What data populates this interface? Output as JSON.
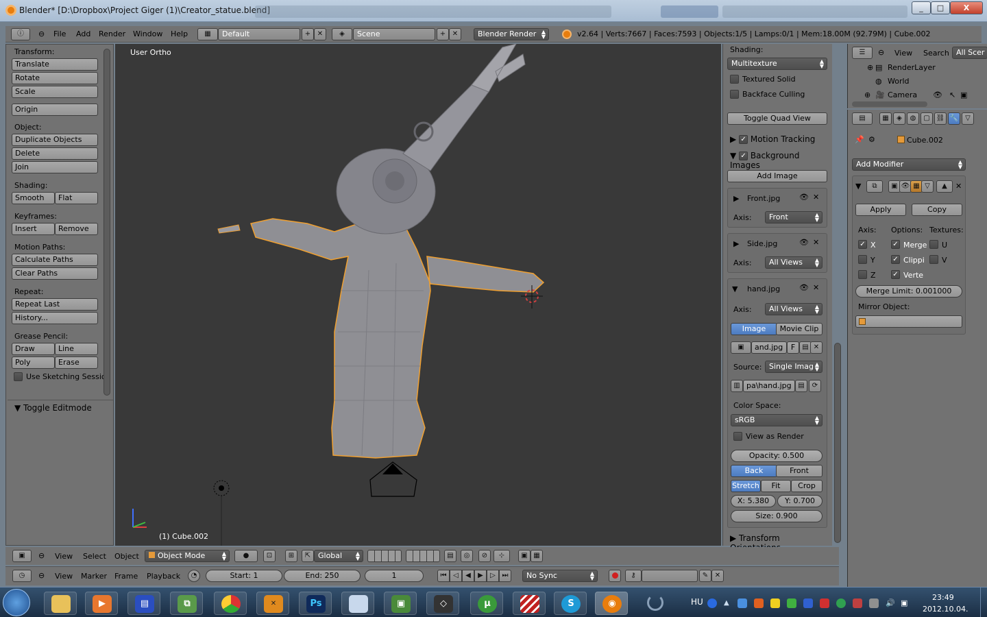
{
  "window": {
    "title": "Blender* [D:\\Dropbox\\Project Giger (1)\\Creator_statue.blend]",
    "min": "_",
    "max": "□",
    "close": "X"
  },
  "info_header": {
    "menus": [
      "File",
      "Add",
      "Render",
      "Window",
      "Help"
    ],
    "layout": "Default",
    "scene": "Scene",
    "engine": "Blender Render",
    "stats": "v2.64 | Verts:7667 | Faces:7593 | Objects:1/5 | Lamps:0/1 | Mem:18.00M (92.79M) | Cube.002"
  },
  "tool_shelf": {
    "transform_label": "Transform:",
    "translate": "Translate",
    "rotate": "Rotate",
    "scale": "Scale",
    "origin": "Origin",
    "object_label": "Object:",
    "duplicate": "Duplicate Objects",
    "delete": "Delete",
    "join": "Join",
    "shading_label": "Shading:",
    "smooth": "Smooth",
    "flat": "Flat",
    "keyframes_label": "Keyframes:",
    "insert": "Insert",
    "remove": "Remove",
    "motion_label": "Motion Paths:",
    "calc_paths": "Calculate Paths",
    "clear_paths": "Clear Paths",
    "repeat_label": "Repeat:",
    "repeat_last": "Repeat Last",
    "history": "History...",
    "grease_label": "Grease Pencil:",
    "draw": "Draw",
    "line": "Line",
    "poly": "Poly",
    "erase": "Erase",
    "sketching": "Use Sketching Sessio",
    "toggle_editmode": "Toggle Editmode"
  },
  "viewport": {
    "view_label": "User Ortho",
    "object_label": "(1) Cube.002"
  },
  "n_panel": {
    "shading_label": "Shading:",
    "shading_mode": "Multitexture",
    "textured_solid": "Textured Solid",
    "backface": "Backface Culling",
    "toggle_quad": "Toggle Quad View",
    "motion_tracking": "Motion Tracking",
    "background_images": "Background Images",
    "add_image": "Add Image",
    "images": [
      {
        "name": "Front.jpg",
        "axis": "Front"
      },
      {
        "name": "Side.jpg",
        "axis": "All Views"
      },
      {
        "name": "hand.jpg",
        "axis": "All Views"
      }
    ],
    "axis_label": "Axis:",
    "tab_image": "Image",
    "tab_movie": "Movie Clip",
    "file_name": "and.jpg",
    "file_flag": "F",
    "source_label": "Source:",
    "source_value": "Single Imag",
    "path_value": "pa\\hand.jpg",
    "color_space_label": "Color Space:",
    "color_space": "sRGB",
    "view_as_render": "View as Render",
    "opacity": "Opacity: 0.500",
    "back": "Back",
    "front": "Front",
    "stretch": "Stretch",
    "fit": "Fit",
    "crop": "Crop",
    "x_val": "X: 5.380",
    "y_val": "Y: 0.700",
    "size_val": "Size: 0.900",
    "transform_orient": "Transform Orientations"
  },
  "outliner": {
    "view": "View",
    "search": "Search",
    "all_scenes": "All Scer",
    "items": [
      "RenderLayer",
      "World",
      "Camera"
    ]
  },
  "properties": {
    "object_name": "Cube.002",
    "add_modifier": "Add Modifier",
    "apply": "Apply",
    "copy": "Copy",
    "axis_label": "Axis:",
    "options_label": "Options:",
    "textures_label": "Textures:",
    "x": "X",
    "y": "Y",
    "z": "Z",
    "merge": "Merge",
    "clipping": "Clippi",
    "vertex": "Verte",
    "u": "U",
    "v": "V",
    "merge_limit": "Merge Limit: 0.001000",
    "mirror_object": "Mirror Object:"
  },
  "view3d_header": {
    "view": "View",
    "select": "Select",
    "object": "Object",
    "mode": "Object Mode",
    "orientation": "Global"
  },
  "timeline": {
    "view": "View",
    "marker": "Marker",
    "frame": "Frame",
    "playback": "Playback",
    "start": "Start: 1",
    "end": "End: 250",
    "current": "1",
    "sync": "No Sync"
  },
  "taskbar": {
    "lang": "HU",
    "time": "23:49",
    "date": "2012.10.04."
  },
  "colors": {
    "accent_selected": "#5680c2",
    "selection_outline": "#f0a030",
    "viewport_bg": "#393939",
    "panel_bg": "#727272"
  }
}
